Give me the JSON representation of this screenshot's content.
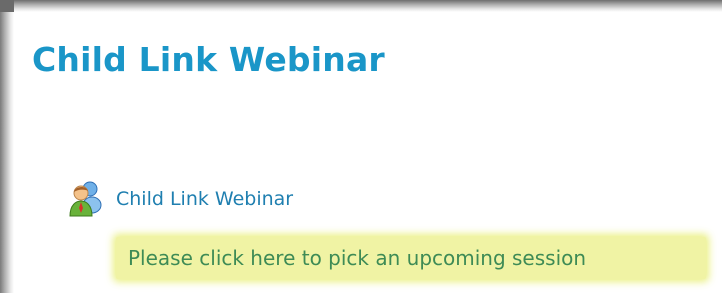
{
  "page": {
    "title": "Child Link Webinar"
  },
  "module": {
    "icon": "webinar-people-icon",
    "link_label": "Child Link Webinar"
  },
  "description": {
    "link_text": "Please click here to pick an upcoming session",
    "highlight_color": "#f0f3a4",
    "text_color": "#3e8b55"
  },
  "colors": {
    "title": "#1a96c8",
    "link": "#1f7fb0"
  }
}
